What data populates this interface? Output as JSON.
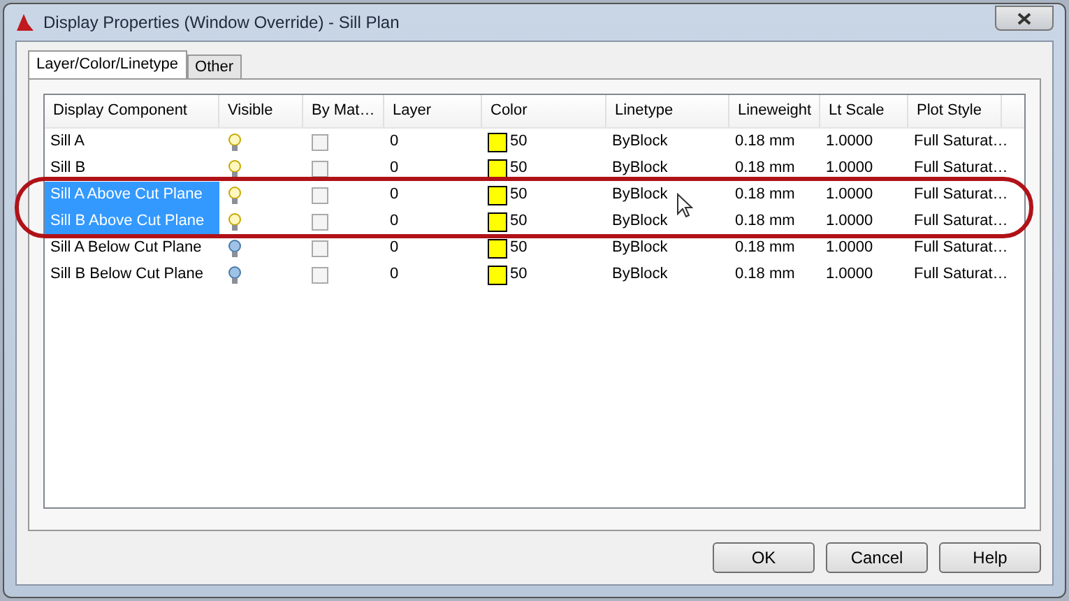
{
  "window": {
    "title": "Display Properties (Window Override) - Sill Plan"
  },
  "tabs": [
    {
      "label": "Layer/Color/Linetype",
      "selected": true
    },
    {
      "label": "Other",
      "selected": false
    }
  ],
  "table": {
    "columns": [
      "Display Component",
      "Visible",
      "By Mat…",
      "Layer",
      "Color",
      "Linetype",
      "Lineweight",
      "Lt Scale",
      "Plot Style"
    ],
    "rows": [
      {
        "component": "Sill A",
        "visible": true,
        "by_material": false,
        "layer": "0",
        "color_index": "50",
        "linetype": "ByBlock",
        "lineweight": "0.18 mm",
        "lt_scale": "1.0000",
        "plot_style": "Full Saturat…",
        "selected": false
      },
      {
        "component": "Sill B",
        "visible": true,
        "by_material": false,
        "layer": "0",
        "color_index": "50",
        "linetype": "ByBlock",
        "lineweight": "0.18 mm",
        "lt_scale": "1.0000",
        "plot_style": "Full Saturat…",
        "selected": false
      },
      {
        "component": "Sill A Above Cut Plane",
        "visible": true,
        "by_material": false,
        "layer": "0",
        "color_index": "50",
        "linetype": "ByBlock",
        "lineweight": "0.18 mm",
        "lt_scale": "1.0000",
        "plot_style": "Full Saturat…",
        "selected": true
      },
      {
        "component": "Sill B Above Cut Plane",
        "visible": true,
        "by_material": false,
        "layer": "0",
        "color_index": "50",
        "linetype": "ByBlock",
        "lineweight": "0.18 mm",
        "lt_scale": "1.0000",
        "plot_style": "Full Saturat…",
        "selected": true
      },
      {
        "component": "Sill A Below Cut Plane",
        "visible": false,
        "by_material": false,
        "layer": "0",
        "color_index": "50",
        "linetype": "ByBlock",
        "lineweight": "0.18 mm",
        "lt_scale": "1.0000",
        "plot_style": "Full Saturat…",
        "selected": false
      },
      {
        "component": "Sill B Below Cut Plane",
        "visible": false,
        "by_material": false,
        "layer": "0",
        "color_index": "50",
        "linetype": "ByBlock",
        "lineweight": "0.18 mm",
        "lt_scale": "1.0000",
        "plot_style": "Full Saturat…",
        "selected": false
      }
    ]
  },
  "buttons": [
    "OK",
    "Cancel",
    "Help"
  ]
}
